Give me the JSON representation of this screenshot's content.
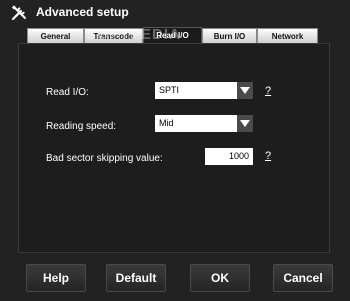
{
  "window": {
    "title": "Advanced setup"
  },
  "tabs": [
    {
      "label": "General"
    },
    {
      "label": "Transcode"
    },
    {
      "label": "Read I/O"
    },
    {
      "label": "Burn I/O"
    },
    {
      "label": "Network"
    }
  ],
  "active_tab": "Read I/O",
  "watermark": "SOFTPEDIA",
  "settings": {
    "read_io": {
      "label": "Read I/O:",
      "value": "SPTI",
      "help": "?"
    },
    "reading_speed": {
      "label": "Reading speed:",
      "value": "Mid"
    },
    "bad_sector": {
      "label": "Bad sector skipping value:",
      "value": "1000",
      "help": "?"
    }
  },
  "buttons": {
    "help": "Help",
    "default": "Default",
    "ok": "OK",
    "cancel": "Cancel"
  },
  "icons": {
    "app": "wrench-screwdriver-icon",
    "dropdown": "triangle-down-icon"
  },
  "colors": {
    "background": "#222222",
    "panel": "#1d1d1d",
    "tab_active": "#1a1a1a"
  }
}
